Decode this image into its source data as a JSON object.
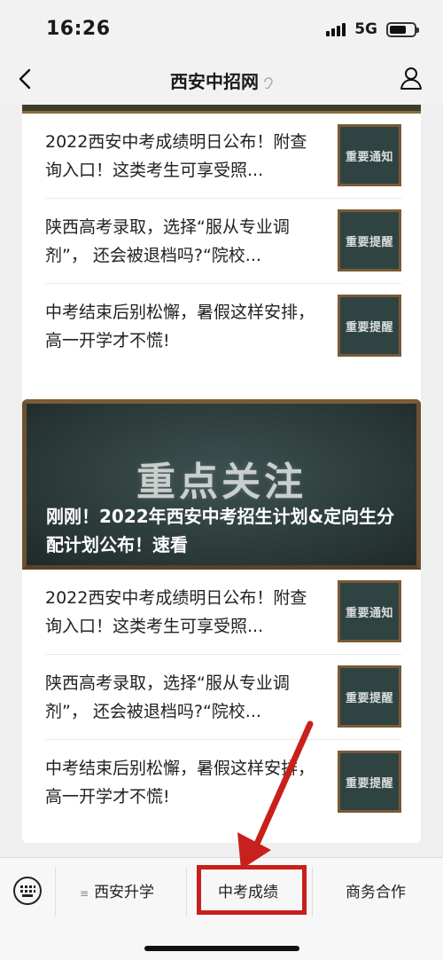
{
  "status_bar": {
    "time": "16:26",
    "network": "5G"
  },
  "nav": {
    "title": "西安中招网",
    "back_icon": "chevron-left-icon",
    "profile_icon": "person-icon"
  },
  "top_card": {
    "articles": [
      {
        "title": "2022西安中考成绩明日公布！附查询入口！这类考生可享受照...",
        "thumb_label": "重要通知"
      },
      {
        "title": "陕西高考录取，选择“服从专业调剂”， 还会被退档吗?“院校...",
        "thumb_label": "重要提醒"
      },
      {
        "title": "中考结束后别松懈，暑假这样安排，高一开学才不慌!",
        "thumb_label": "重要提醒"
      }
    ]
  },
  "second_card": {
    "banner_heading": "重点关注",
    "banner_title": "刚刚！2022年西安中考招生计划&定向生分配计划公布！速看",
    "articles": [
      {
        "title": "2022西安中考成绩明日公布！附查询入口！这类考生可享受照...",
        "thumb_label": "重要通知"
      },
      {
        "title": "陕西高考录取，选择“服从专业调剂”， 还会被退档吗?“院校...",
        "thumb_label": "重要提醒"
      },
      {
        "title": "中考结束后别松懈，暑假这样安排，高一开学才不慌!",
        "thumb_label": "重要提醒"
      }
    ]
  },
  "bottom_menu": {
    "items": [
      {
        "label": "西安升学"
      },
      {
        "label": "中考成绩"
      },
      {
        "label": "商务合作"
      }
    ]
  },
  "colors": {
    "annotation_red": "#c8201c",
    "board_green": "#2f4343",
    "board_frame": "#7a5a35"
  }
}
